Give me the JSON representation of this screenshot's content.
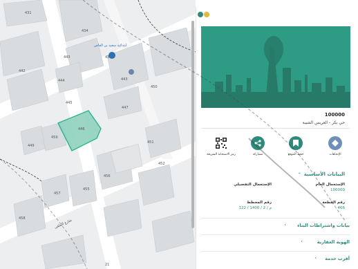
{
  "map": {
    "plots": [
      "431",
      "434",
      "438",
      "443",
      "443",
      "442",
      "444",
      "445",
      "446",
      "447",
      "449",
      "450",
      "451",
      "452",
      "455",
      "456",
      "457",
      "458",
      "459"
    ],
    "poi_label": "ابتدائية سعيد بن العاص",
    "street_label": "شارع الملقى",
    "bottom_number": "21",
    "selected_color": "#2fb38f"
  },
  "panel": {
    "plot_number": "100000",
    "district": "حي بكر - العريس الشيبة",
    "actions": [
      {
        "label": "الإتجاهات",
        "icon": "directions-icon"
      },
      {
        "label": "حفظ الموقع",
        "icon": "bookmark-icon"
      },
      {
        "label": "مشاركة",
        "icon": "share-icon"
      },
      {
        "label": "رمز الاستجابة السريعة",
        "icon": "qr-code-icon"
      }
    ],
    "basic_section_title": "البيانات الأساسية",
    "general_use_label": "الإستعمال العام",
    "general_use_value": "100000",
    "detailed_use_label": "الإستعمال التفصيلي",
    "detailed_use_value": "",
    "plot_no_label": "رقم القطعة",
    "plot_no_value": "466",
    "plan_no_label": "رقم المخطط",
    "plan_no_value": "122 / 1400 / 2 / م",
    "sections": [
      "بيانات واشتراطات البناء",
      "الهوية العقارية",
      "أقرب خدمة"
    ]
  },
  "colors": {
    "accent": "#2e8a7a",
    "hero_bg": "#2e9c85",
    "action_green": "#2e8a7a",
    "action_blue": "#6e8fb8"
  }
}
